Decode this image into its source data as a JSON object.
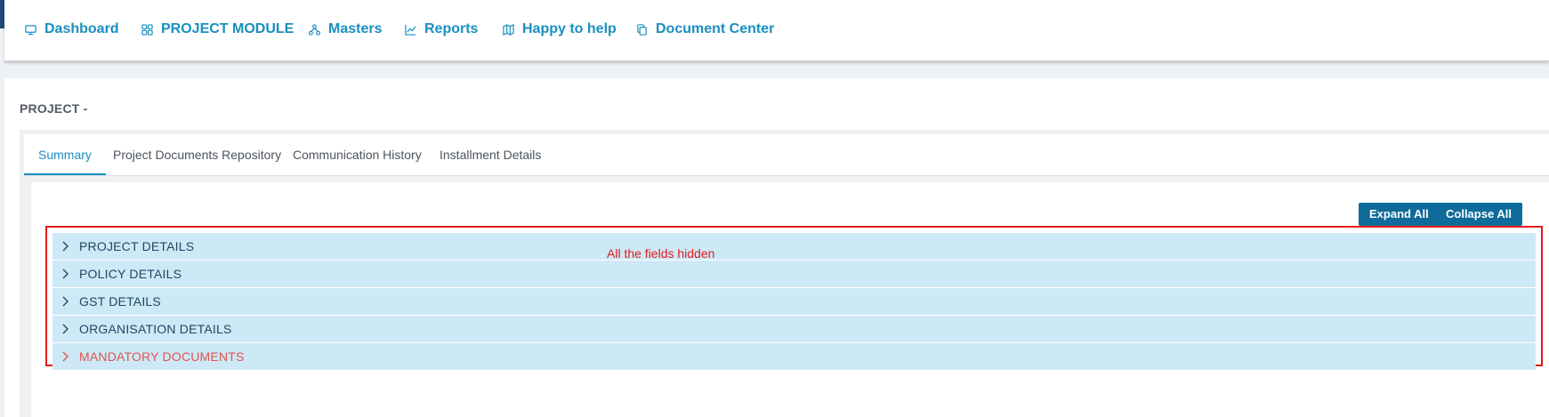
{
  "nav": [
    {
      "label": "Dashboard",
      "icon": "monitor-icon"
    },
    {
      "label": "PROJECT MODULE",
      "icon": "grid-icon"
    },
    {
      "label": "Masters",
      "icon": "sitemap-icon"
    },
    {
      "label": "Reports",
      "icon": "line-chart-icon"
    },
    {
      "label": "Happy to help",
      "icon": "map-icon"
    },
    {
      "label": "Document Center",
      "icon": "copy-icon"
    }
  ],
  "page": {
    "title": "PROJECT -"
  },
  "tabs": [
    {
      "label": "Summary",
      "active": true
    },
    {
      "label": "Project Documents Repository",
      "active": false
    },
    {
      "label": "Communication History",
      "active": false
    },
    {
      "label": "Installment Details",
      "active": false
    }
  ],
  "toolbar": {
    "expand_all": "Expand All",
    "collapse_all": "Collapse All"
  },
  "sections": [
    {
      "label": "PROJECT DETAILS"
    },
    {
      "label": "POLICY DETAILS"
    },
    {
      "label": "GST DETAILS"
    },
    {
      "label": "ORGANISATION DETAILS"
    },
    {
      "label": "MANDATORY DOCUMENTS",
      "highlight": true
    }
  ],
  "annotation": {
    "text": "All the fields hidden"
  },
  "colors": {
    "accent": "#1a8fc0",
    "button": "#0f6b99",
    "section_bg": "#cde9f6",
    "warning_text": "#e0534f",
    "annotation": "#e31b1b"
  }
}
